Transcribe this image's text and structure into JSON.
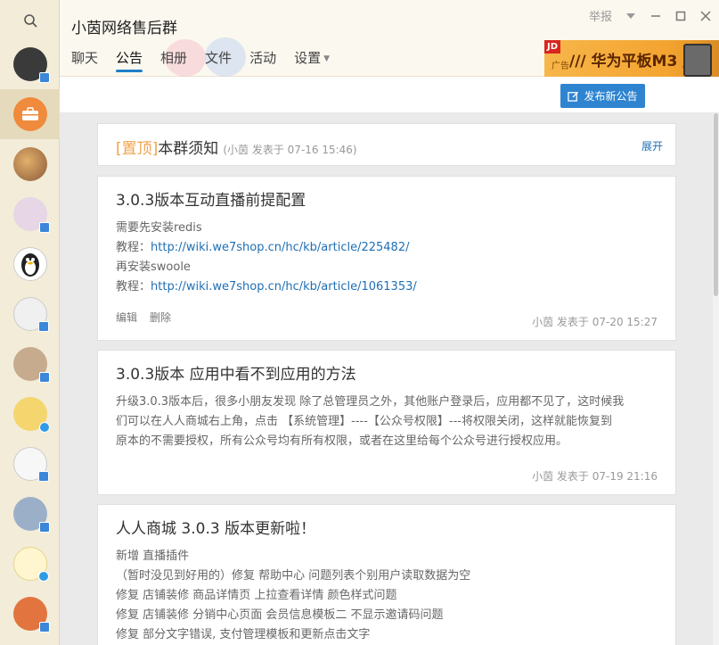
{
  "header": {
    "group_name": "小茵网络售后群",
    "report": "举报",
    "tabs": [
      {
        "label": "聊天"
      },
      {
        "label": "公告"
      },
      {
        "label": "相册"
      },
      {
        "label": "文件"
      },
      {
        "label": "活动"
      },
      {
        "label": "设置"
      }
    ],
    "ad": {
      "badge": "JD",
      "small": "广告",
      "text": "/// 华为平板M3 ///"
    }
  },
  "toolbar": {
    "publish_label": "发布新公告"
  },
  "pinned": {
    "tag": "[置顶]",
    "title": "本群须知",
    "meta": "(小茵 发表于 07-16 15:46)",
    "expand": "展开"
  },
  "announcements": [
    {
      "title": "3.0.3版本互动直播前提配置",
      "lines": [
        {
          "text": "需要先安装redis"
        },
        {
          "prefix": "教程：",
          "link": "http://wiki.we7shop.cn/hc/kb/article/225482/"
        },
        {
          "text": "再安装swoole"
        },
        {
          "prefix": "教程：",
          "link": "http://wiki.we7shop.cn/hc/kb/article/1061353/"
        }
      ],
      "actions": [
        "编辑",
        "删除"
      ],
      "meta": "小茵 发表于 07-20 15:27"
    },
    {
      "title": "3.0.3版本  应用中看不到应用的方法",
      "lines": [
        {
          "text": "升级3.0.3版本后，很多小朋友发现 除了总管理员之外，其他账户登录后，应用都不见了，这时候我"
        },
        {
          "text": "们可以在人人商城右上角，点击 【系统管理】----【公众号权限】---将权限关闭，这样就能恢复到"
        },
        {
          "text": "原本的不需要授权，所有公众号均有所有权限，或者在这里给每个公众号进行授权应用。"
        }
      ],
      "meta": "小茵 发表于 07-19 21:16"
    },
    {
      "title": "人人商城 3.0.3 版本更新啦！",
      "lines": [
        {
          "text": "新增 直播插件"
        },
        {
          "text": "（暂时没见到好用的）修复 帮助中心 问题列表个别用户读取数据为空"
        },
        {
          "text": "修复 店铺装修 商品详情页 上拉查看详情 颜色样式问题"
        },
        {
          "text": "修复 店铺装修 分销中心页面 会员信息模板二 不显示邀请码问题"
        },
        {
          "text": "修复 部分文字错误, 支付管理模板和更新点击文字"
        }
      ]
    }
  ],
  "rail": {
    "avatar_colors": [
      "#3a3a3a",
      "#f08a3c",
      "#c49a6a",
      "#d8c3d8",
      "#2b2b2b",
      "#e8e8e8",
      "#c0a58a",
      "#f2d26a",
      "#f5f5f5",
      "#8aa0b8",
      "#fff4c8",
      "#e0703a"
    ]
  },
  "colors": {
    "accent": "#2f84d0",
    "pin": "#f0a24a",
    "link": "#1f6fb4"
  }
}
